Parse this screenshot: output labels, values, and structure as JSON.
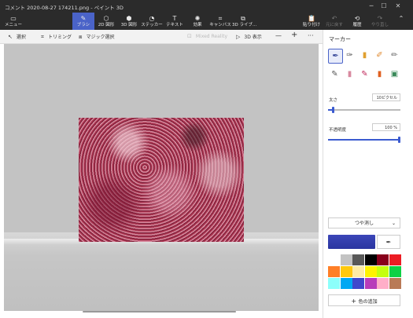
{
  "window": {
    "title": "コメント 2020-08-27 174211.png - ペイント 3D",
    "minimize": "─",
    "maximize": "☐",
    "close": "✕"
  },
  "ribbon": {
    "menu": {
      "label": "メニュー",
      "icon": "folder-icon",
      "glyph": "▭"
    },
    "tools": [
      {
        "label": "ブラシ",
        "icon": "brush-icon",
        "glyph": "✎"
      },
      {
        "label": "2D 図形",
        "icon": "shape-2d-icon",
        "glyph": "⬡"
      },
      {
        "label": "3D 図形",
        "icon": "cube-icon",
        "glyph": "⬢"
      },
      {
        "label": "ステッカー",
        "icon": "sticker-icon",
        "glyph": "◔"
      },
      {
        "label": "テキスト",
        "icon": "text-icon",
        "glyph": "T"
      },
      {
        "label": "効果",
        "icon": "effects-icon",
        "glyph": "✺"
      },
      {
        "label": "キャンバス",
        "icon": "canvas-icon",
        "glyph": "⌗"
      },
      {
        "label": "3D ライブ...",
        "icon": "library-icon",
        "glyph": "⧉"
      }
    ],
    "actions": [
      {
        "label": "貼り付け",
        "icon": "paste-icon",
        "glyph": "📋"
      },
      {
        "label": "元に戻す",
        "icon": "undo-icon",
        "glyph": "↶"
      },
      {
        "label": "履歴",
        "icon": "history-icon",
        "glyph": "⟲"
      },
      {
        "label": "やり直し",
        "icon": "redo-icon",
        "glyph": "↷"
      }
    ],
    "collapse_glyph": "⌃"
  },
  "toolbar": {
    "select": "選択",
    "crop": "トリミング",
    "magic_select": "マジック選択",
    "mixed_reality": "Mixed Reality",
    "view3d": "3D 表示",
    "zoom_out": "—",
    "zoom_in": "+",
    "more": "···"
  },
  "panel": {
    "title": "マーカー",
    "brushes": [
      {
        "name": "marker",
        "glyph": "✒",
        "color": "#3a4a9a"
      },
      {
        "name": "calligraphy-pen",
        "glyph": "✑",
        "color": "#555"
      },
      {
        "name": "oil-brush",
        "glyph": "▮",
        "color": "#e0a030"
      },
      {
        "name": "watercolor",
        "glyph": "✐",
        "color": "#e08a30"
      },
      {
        "name": "pixel-pen",
        "glyph": "✏",
        "color": "#666"
      },
      {
        "name": "pencil",
        "glyph": "✎",
        "color": "#555"
      },
      {
        "name": "eraser",
        "glyph": "▮",
        "color": "#d88aa0"
      },
      {
        "name": "crayon",
        "glyph": "✎",
        "color": "#c0285a"
      },
      {
        "name": "spray-can",
        "glyph": "▮",
        "color": "#e06020"
      },
      {
        "name": "fill",
        "glyph": "▣",
        "color": "#3a8a5a"
      }
    ],
    "size_label": "太さ",
    "size_value": "10ピクセル",
    "size_fraction": 0.05,
    "opacity_label": "不透明度",
    "opacity_value": "100 %",
    "opacity_fraction": 1.0,
    "finish": "つや消し",
    "current_color": "#3b46b8",
    "palette": [
      "#ffffff",
      "#c3c3c3",
      "#585858",
      "#000000",
      "#88001b",
      "#ec1c24",
      "#ff7f27",
      "#ffc90e",
      "#fdeca6",
      "#fff200",
      "#c4ff0e",
      "#0ed145",
      "#8cfffb",
      "#00a8f3",
      "#3f48cc",
      "#b83dba",
      "#ffaec8",
      "#b97a56"
    ],
    "add_color": "色の追加"
  }
}
